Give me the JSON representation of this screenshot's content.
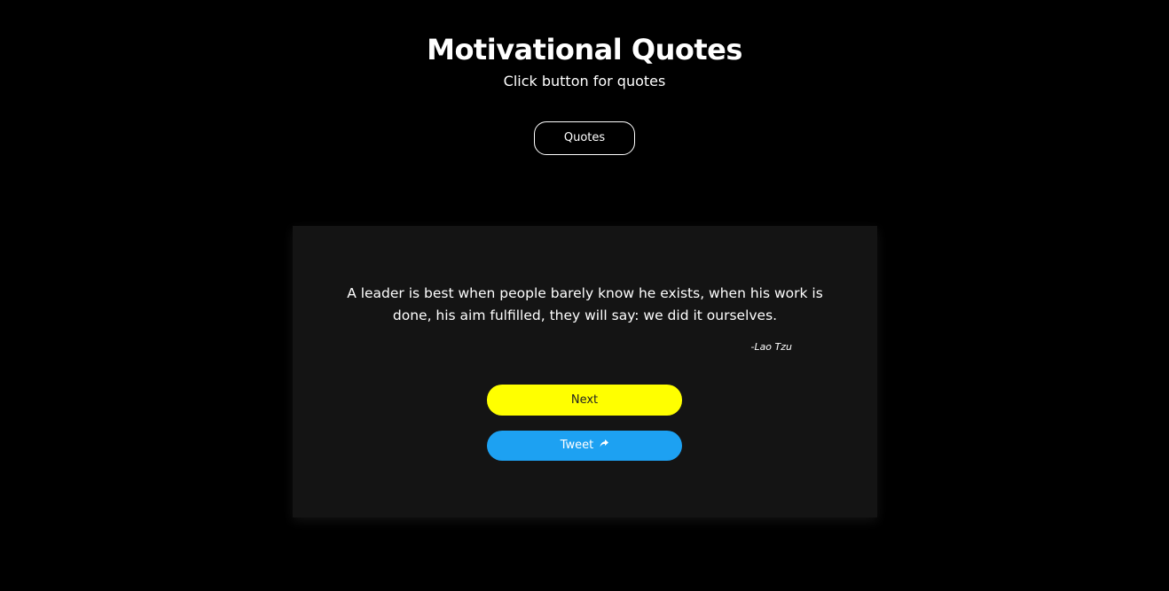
{
  "header": {
    "title": "Motivational Quotes",
    "subtitle": "Click button for quotes",
    "quotes_button_label": "Quotes"
  },
  "quote_card": {
    "text": "A leader is best when people barely know he exists, when his work is done, his aim fulfilled, they will say: we did it ourselves.",
    "author": "-Lao Tzu",
    "next_button_label": "Next",
    "tweet_button_label": "Tweet",
    "tweet_icon": "share-icon"
  },
  "colors": {
    "background": "#000000",
    "card_background": "#141414",
    "next_button": "#ffff00",
    "tweet_button": "#1da1f2",
    "text": "#ffffff"
  }
}
